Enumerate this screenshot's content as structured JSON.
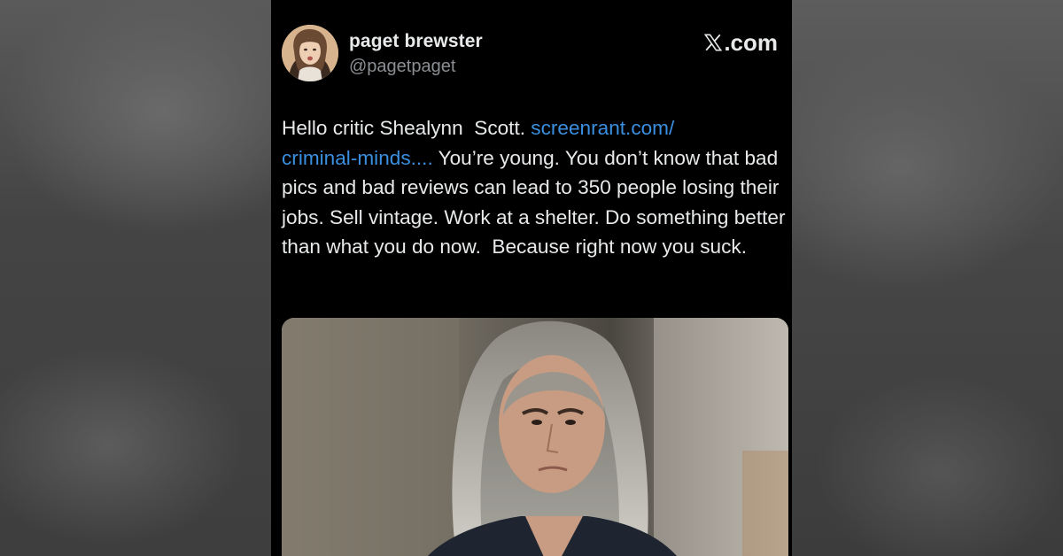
{
  "author": {
    "display_name": "paget brewster",
    "handle": "@pagetpaget"
  },
  "brand": {
    "label": ".com",
    "logo_icon": "x-logo-icon"
  },
  "tweet": {
    "intro": "Hello critic Shealynn  Scott. ",
    "link_line1": "screenrant.com/",
    "link_line2": "criminal-minds....",
    "body": " You’re young. You don’t know that bad pics and bad reviews can lead to 350 people losing their jobs. Sell vintage. Work at a shelter. Do something better than what you do now.  Because right now you suck."
  },
  "colors": {
    "background": "#000000",
    "text": "#e7e9ea",
    "handle": "#8b8f93",
    "link": "#3b8fe0"
  }
}
